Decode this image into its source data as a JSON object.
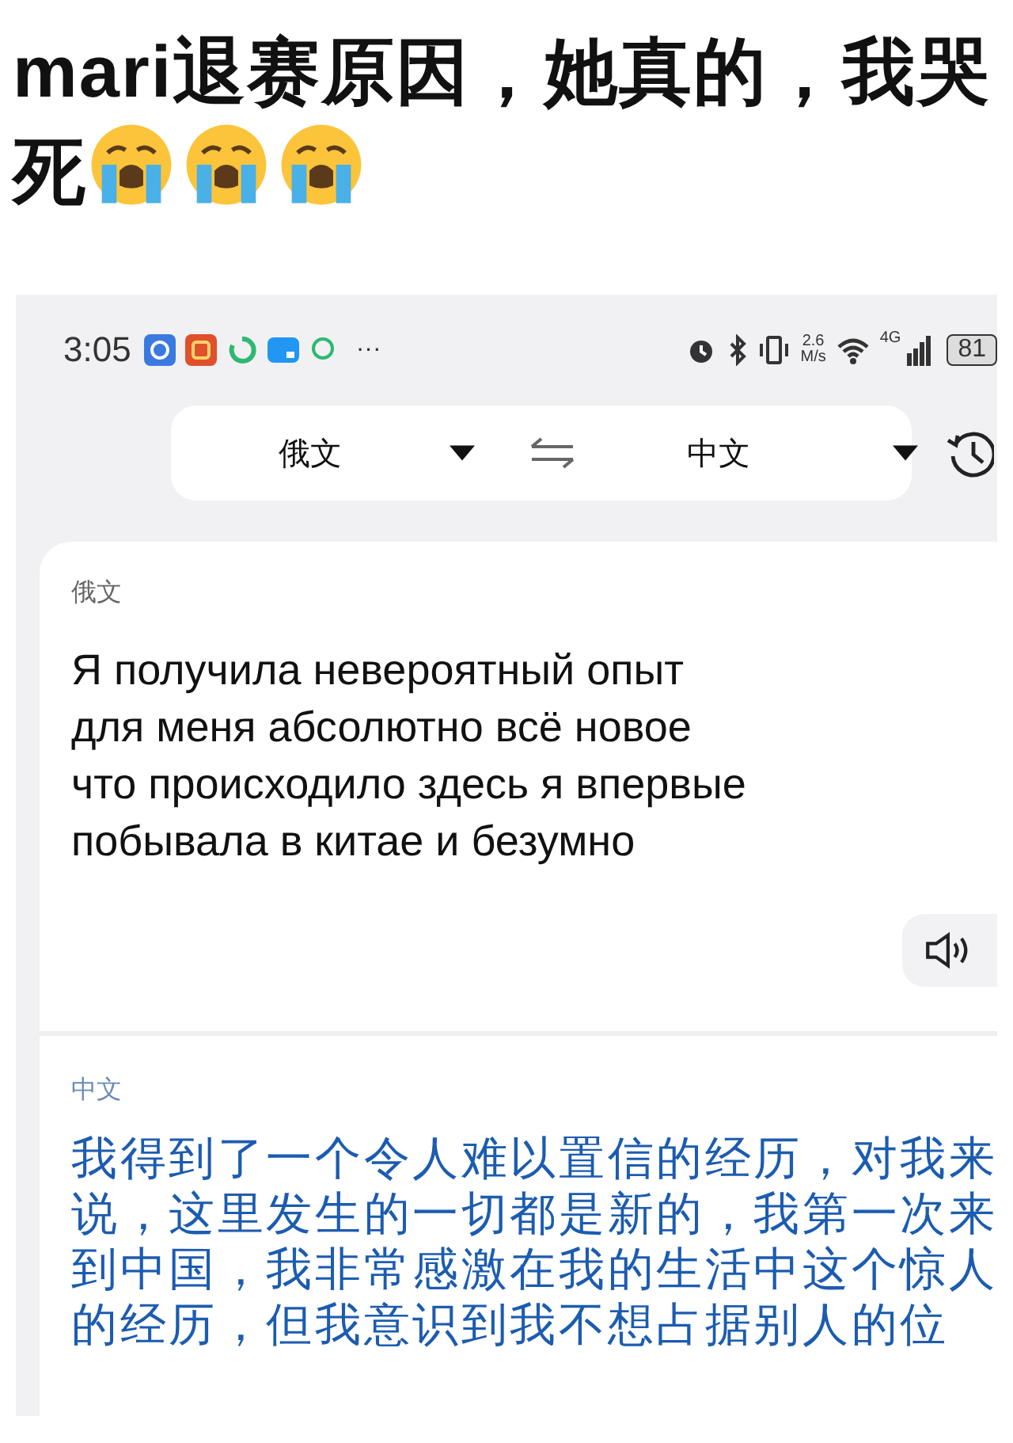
{
  "post_title": "mari退赛原因，她真的，我哭死",
  "status_bar": {
    "time": "3:05",
    "more": "···",
    "speed_value": "2.6",
    "speed_unit": "M/s",
    "network": "4G",
    "battery": "81"
  },
  "language_bar": {
    "source": "俄文",
    "target": "中文"
  },
  "source": {
    "label": "俄文",
    "text": "Я получила невероятный опыт\nдля меня абсолютно всё новое\nчто происходило здесь я впервые\nпобывала в китае и безумно"
  },
  "translation": {
    "label": "中文",
    "text": "我得到了一个令人难以置信的经历，对我来说，这里发生的一切都是新的，我第一次来到中国，我非常感激在我的生活中这个惊人的经历，但我意识到我不想占据别人的位"
  }
}
